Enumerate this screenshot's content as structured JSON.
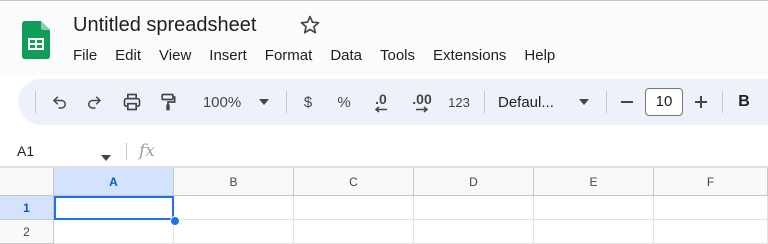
{
  "app": {
    "title": "Untitled spreadsheet",
    "brand_color": "#0f9d58"
  },
  "menu": [
    "File",
    "Edit",
    "View",
    "Insert",
    "Format",
    "Data",
    "Tools",
    "Extensions",
    "Help"
  ],
  "toolbar": {
    "zoom": "100%",
    "currency": "$",
    "percent": "%",
    "decrease_decimal": ".0",
    "increase_decimal": ".00",
    "more_formats": "123",
    "font": "Defaul...",
    "font_size": "10",
    "bold": "B"
  },
  "formula_bar": {
    "name_box": "A1",
    "fx": "fx"
  },
  "sheet": {
    "columns": [
      "A",
      "B",
      "C",
      "D",
      "E",
      "F"
    ],
    "rows": [
      "1",
      "2"
    ],
    "selected_cell": "A1",
    "accent_color": "#1a73e8"
  }
}
